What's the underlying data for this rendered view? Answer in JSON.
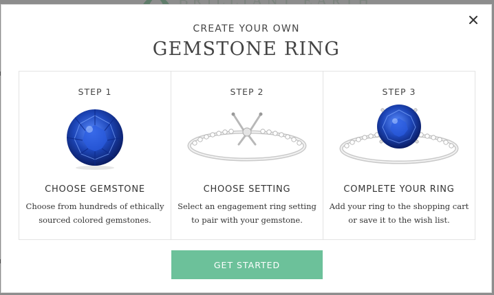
{
  "background": {
    "brand_text": "BRILLIANT EARTH"
  },
  "modal": {
    "close_icon": "close-icon",
    "kicker": "CREATE YOUR OWN",
    "title": "GEMSTONE RING",
    "steps": [
      {
        "label": "STEP 1",
        "image": "blue-sapphire-gemstone",
        "heading": "CHOOSE GEMSTONE",
        "description_lines": [
          "Choose from hundreds of ethically",
          "sourced colored gemstones."
        ]
      },
      {
        "label": "STEP 2",
        "image": "empty-ring-setting",
        "heading": "CHOOSE SETTING",
        "description_lines": [
          "Select an engagement ring setting",
          "to pair with your gemstone."
        ]
      },
      {
        "label": "STEP 3",
        "image": "completed-sapphire-ring",
        "heading": "COMPLETE YOUR RING",
        "description_lines": [
          "Add your ring to the shopping cart",
          "or save it to the wish list."
        ]
      }
    ],
    "cta_label": "GET STARTED"
  },
  "colors": {
    "accent": "#6cc19a",
    "text": "#444444",
    "overlay": "#8d8d8d",
    "sapphire": "#1d46b8"
  }
}
